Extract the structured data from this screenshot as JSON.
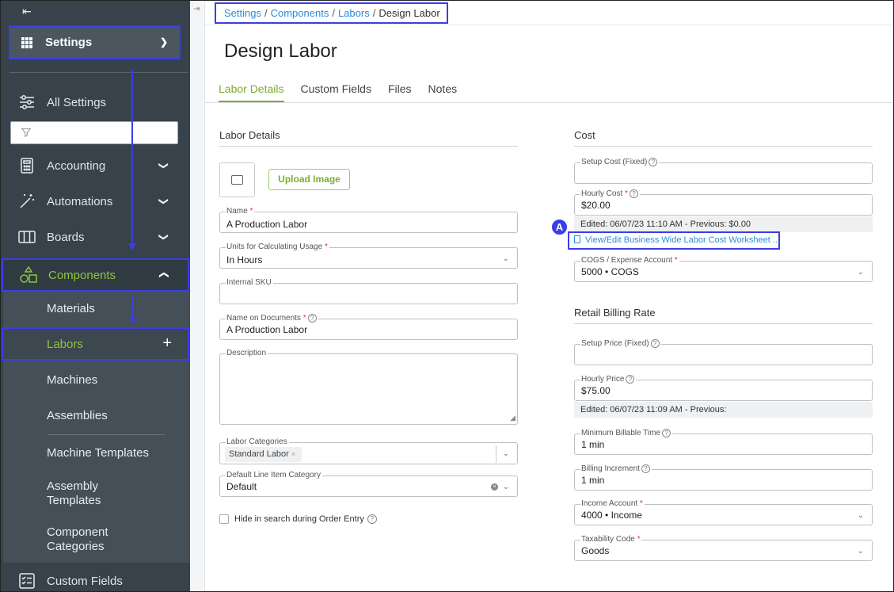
{
  "sidebar": {
    "back_label": "⇤",
    "settings_label": "Settings",
    "filter_placeholder": "",
    "items": [
      {
        "label": "All Settings"
      },
      {
        "label": "Accounting"
      },
      {
        "label": "Automations"
      },
      {
        "label": "Boards"
      },
      {
        "label": "Components"
      }
    ],
    "subitems": [
      {
        "label": "Materials"
      },
      {
        "label": "Labors"
      },
      {
        "label": "Machines"
      },
      {
        "label": "Assemblies"
      },
      {
        "label": "Machine Templates"
      },
      {
        "label": "Assembly Templates"
      },
      {
        "label": "Component Categories"
      }
    ],
    "custom_fields_label": "Custom Fields"
  },
  "breadcrumb": {
    "items": [
      "Settings",
      "Components",
      "Labors"
    ],
    "current": "Design Labor"
  },
  "page_title": "Design Labor",
  "tabs": [
    "Labor Details",
    "Custom Fields",
    "Files",
    "Notes"
  ],
  "labor_details": {
    "section_title": "Labor Details",
    "upload_label": "Upload Image",
    "name": {
      "label": "Name",
      "value": "A Production Labor"
    },
    "units": {
      "label": "Units for Calculating Usage",
      "value": "In Hours"
    },
    "internal_sku": {
      "label": "Internal SKU",
      "value": ""
    },
    "name_on_docs": {
      "label": "Name on Documents",
      "value": "A Production Labor"
    },
    "description": {
      "label": "Description",
      "value": ""
    },
    "labor_categories": {
      "label": "Labor Categories",
      "chip": "Standard Labor"
    },
    "default_line_item": {
      "label": "Default Line Item Category",
      "value": "Default"
    },
    "hide_in_search_label": "Hide in search during Order Entry"
  },
  "cost": {
    "section_title": "Cost",
    "setup_cost": {
      "label": "Setup Cost (Fixed)",
      "value": ""
    },
    "hourly_cost": {
      "label": "Hourly Cost",
      "value": "$20.00"
    },
    "hourly_note": "Edited: 06/07/23 11:10 AM - Previous: $0.00",
    "worksheet_link": "View/Edit Business Wide Labor Cost Worksheet ...",
    "callout": "A",
    "cogs": {
      "label": "COGS / Expense Account",
      "value": "5000 • COGS"
    }
  },
  "retail": {
    "section_title": "Retail Billing Rate",
    "setup_price": {
      "label": "Setup Price (Fixed)",
      "value": ""
    },
    "hourly_price": {
      "label": "Hourly Price",
      "value": "$75.00"
    },
    "hourly_note": "Edited: 06/07/23 11:09 AM - Previous:",
    "min_billable": {
      "label": "Minimum Billable Time",
      "value": "1 min"
    },
    "billing_increment": {
      "label": "Billing Increment",
      "value": "1 min"
    },
    "income_account": {
      "label": "Income Account",
      "value": "4000 • Income"
    },
    "taxability": {
      "label": "Taxability Code",
      "value": "Goods"
    }
  },
  "colors": {
    "accent": "#7aae32",
    "highlight": "#3a3ee8",
    "link": "#2a8dd4",
    "sidebar": "#37424a"
  }
}
